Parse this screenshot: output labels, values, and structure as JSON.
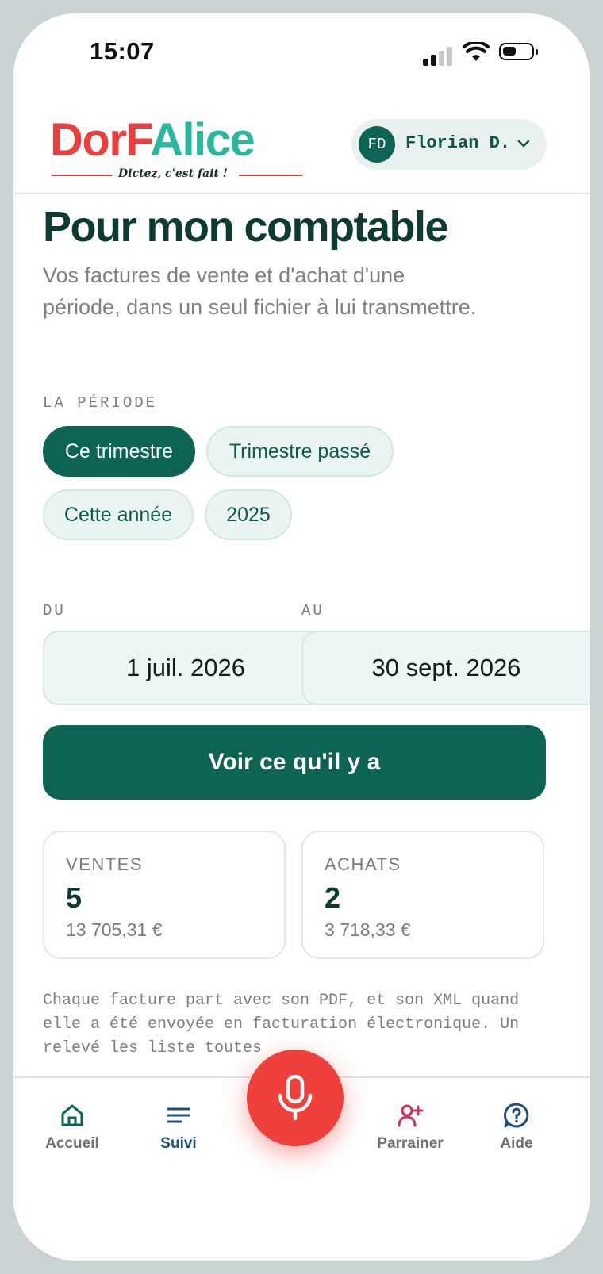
{
  "status_bar": {
    "time": "15:07"
  },
  "header": {
    "logo": {
      "part1": "DorF",
      "part2": "Alice",
      "tagline": "Dictez, c'est fait !"
    },
    "user": {
      "initials": "FD",
      "name": "Florian D."
    }
  },
  "page": {
    "title": "Pour mon comptable",
    "description": "Vos factures de vente et d'achat d'une période, dans un seul fichier à lui transmettre."
  },
  "period": {
    "label": "LA PÉRIODE",
    "options": [
      "Ce trimestre",
      "Trimestre passé",
      "Cette année",
      "2025"
    ],
    "selected": "Ce trimestre"
  },
  "dates": {
    "from_label": "DU",
    "from_value": "1 juil. 2026",
    "to_label": "AU",
    "to_value": "30 sept. 2026"
  },
  "cta": {
    "label": "Voir ce qu'il y a"
  },
  "stats": {
    "sales": {
      "label": "VENTES",
      "count": "5",
      "amount": "13 705,31 €"
    },
    "purchases": {
      "label": "ACHATS",
      "count": "2",
      "amount": "3 718,33 €"
    }
  },
  "footnote": "Chaque facture part avec son PDF, et son XML quand elle a été envoyée en facturation électronique. Un relevé les liste toutes",
  "nav": {
    "items": [
      {
        "label": "Accueil",
        "icon": "home-icon"
      },
      {
        "label": "Suivi",
        "icon": "list-icon"
      },
      {
        "label": "Parrainer",
        "icon": "user-plus-icon"
      },
      {
        "label": "Aide",
        "icon": "help-icon"
      }
    ],
    "active": "Suivi",
    "mic_icon": "microphone-icon"
  },
  "colors": {
    "primary": "#0e6454",
    "logo_red": "#e8403e",
    "logo_teal": "#2ab7a0",
    "mic": "#f0403b",
    "nav_active": "#1e4f80",
    "parrainer_icon": "#c8335a"
  }
}
